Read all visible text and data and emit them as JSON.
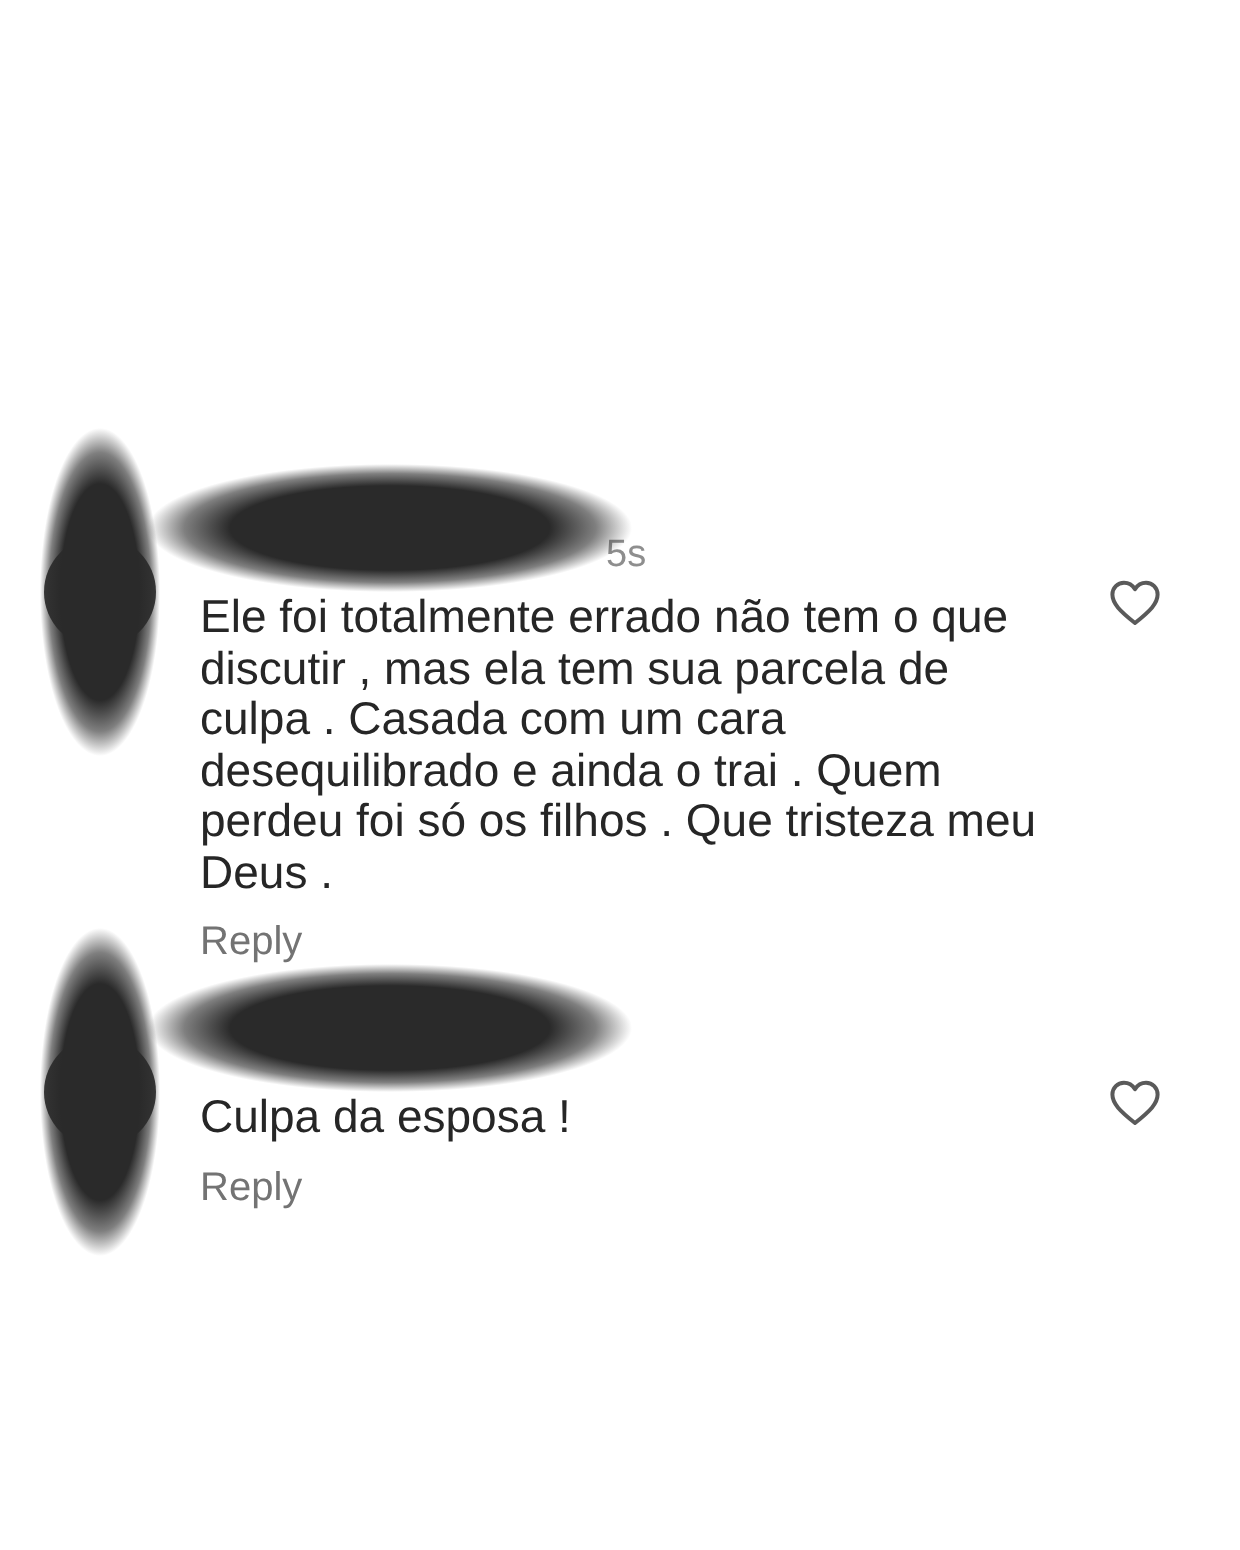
{
  "comments": [
    {
      "timestamp": "5s",
      "text": "Ele foi totalmente errado não tem o que discutir , mas ela tem sua parcela de culpa . Casada com um cara desequilibrado e ainda o trai . Quem perdeu foi só os filhos . Que tristeza meu Deus .",
      "reply": "Reply",
      "liked": false
    },
    {
      "text": "Culpa da esposa !",
      "reply": "Reply",
      "liked": false
    }
  ]
}
